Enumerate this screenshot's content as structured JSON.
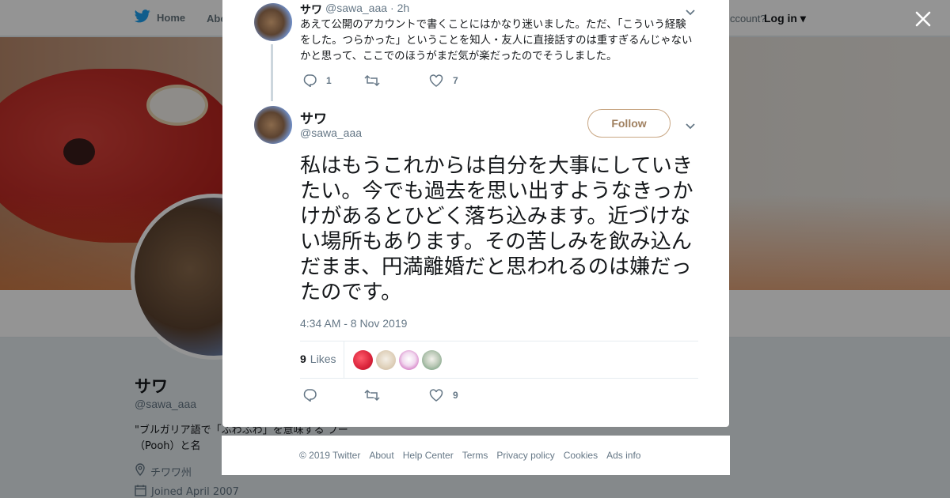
{
  "nav": {
    "home_label": "Home",
    "about_label": "Abo",
    "account_prompt": "ccount?",
    "login_label": "Log in"
  },
  "profile": {
    "name": "サワ",
    "handle": "@sawa_aaa",
    "bio": "\"ブルガリア語で「ふわふわ」を意味する プー（Pooh）と名",
    "location": "チワワ州",
    "joined": "Joined April 2007"
  },
  "previous_tweet": {
    "name": "サワ",
    "handle": "@sawa_aaa",
    "time": "· 2h",
    "text": "あえて公開のアカウントで書くことにはかなり迷いました。ただ、「こういう経験をした。つらかった」ということを知人・友人に直接話すのは重すぎるんじゃないかと思って、ここでのほうがまだ気が楽だったのでそうしました。",
    "replies": "1",
    "retweets": "",
    "likes": "7"
  },
  "tweet": {
    "name": "サワ",
    "handle": "@sawa_aaa",
    "follow_label": "Follow",
    "text": "私はもうこれからは自分を大事にしていきたい。今でも過去を思い出すようなきっかけがあるとひどく落ち込みます。近づけない場所もあります。その苦しみを飲み込んだまま、円満離婚だと思われるのは嫌だったのです。",
    "timestamp": "4:34 AM - 8 Nov 2019",
    "likes_count": "9",
    "likes_label": "Likes",
    "replies": "",
    "retweets": "",
    "likes": "9"
  },
  "footer": {
    "links": [
      "© 2019 Twitter",
      "About",
      "Help Center",
      "Terms",
      "Privacy policy",
      "Cookies",
      "Ads info"
    ]
  },
  "colors": {
    "twitter_blue": "#1da1f2",
    "follow_border": "#c8a683",
    "muted_text": "#657786"
  }
}
